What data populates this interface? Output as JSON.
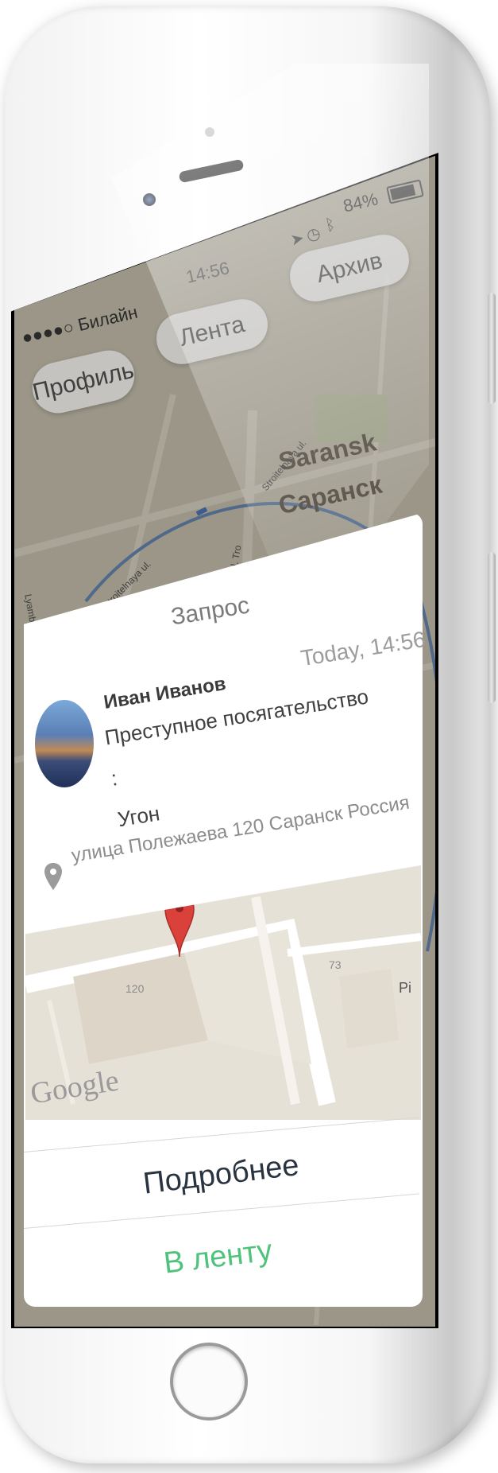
{
  "status_bar": {
    "carrier": "●●●●○ Билайн",
    "time": "14:56",
    "battery": "84%"
  },
  "nav": {
    "profile": "Профиль",
    "feed": "Лента",
    "archive": "Архив"
  },
  "map": {
    "city_en": "Saransk",
    "city_ru": "Саранск",
    "streets": [
      "Stroitelnaya ul.",
      "Stroitelnaya ul.",
      "ul. Tro",
      "Lyambirsko"
    ]
  },
  "request": {
    "title": "Запрос",
    "time": "Today, 14:56",
    "user_name": "Иван Иванов",
    "crime_line1": "Преступное посягательство :",
    "crime_line2": "Угон",
    "address": "улица Полежаева 120 Саранск Россия",
    "map_numbers": [
      "120",
      "73"
    ],
    "map_google": "Google",
    "map_street_fragment": "Pi"
  },
  "actions": {
    "details": "Подробнее",
    "to_feed": "В ленту"
  },
  "colors": {
    "accent_green": "#4fc27b",
    "details_text": "#2a3440",
    "pin_red": "#d9413a"
  }
}
